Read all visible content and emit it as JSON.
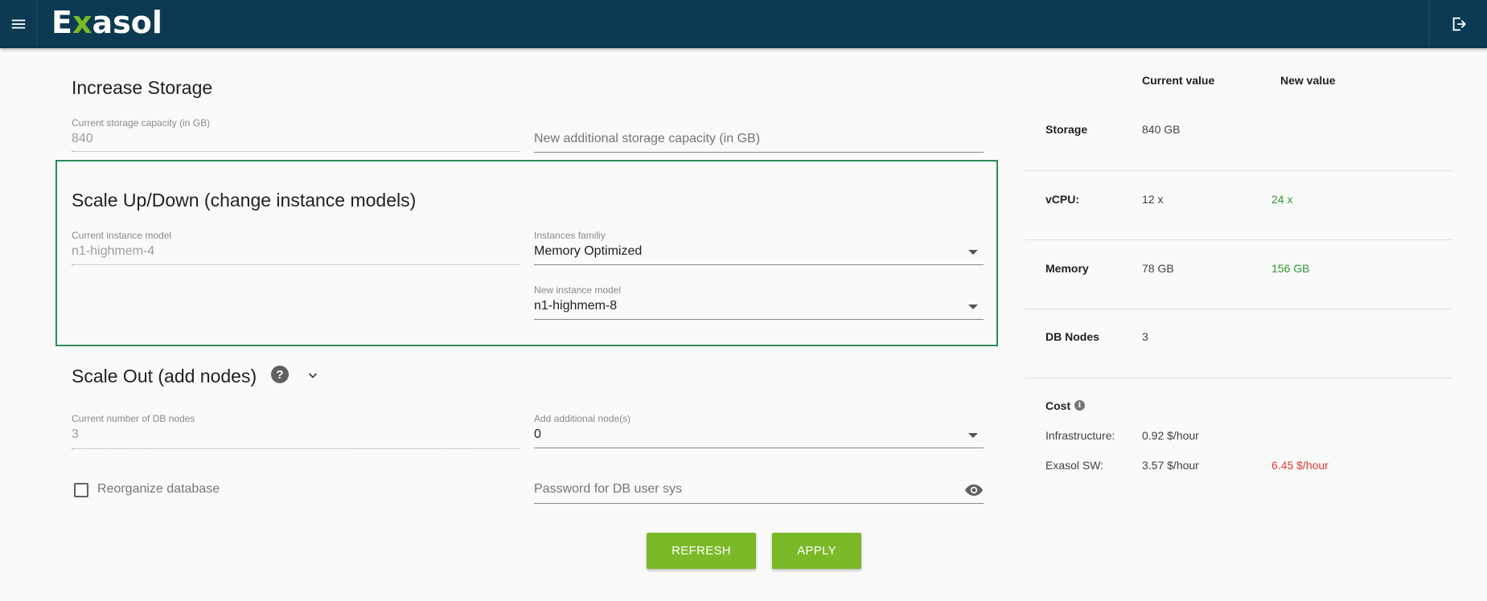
{
  "header": {
    "logo_pre": "E",
    "logo_x": "x",
    "logo_post": "asol",
    "menu_icon": "hamburger-menu-icon",
    "logout_icon": "logout-icon"
  },
  "storage": {
    "title": "Increase Storage",
    "current_label": "Current storage capacity (in GB)",
    "current_value": "840",
    "new_placeholder": "New additional storage capacity (in GB)"
  },
  "scale_updown": {
    "title": "Scale Up/Down (change instance models)",
    "current_label": "Current instance model",
    "current_value": "n1-highmem-4",
    "family_label": "Instances familiy",
    "family_value": "Memory Optimized",
    "new_model_label": "New instance model",
    "new_model_value": "n1-highmem-8",
    "highlight_color": "#2e8b57"
  },
  "scale_out": {
    "title": "Scale Out (add nodes)",
    "help_icon": "help-circle-icon",
    "chevron_icon": "chevron-down-icon",
    "current_label": "Current number of DB nodes",
    "current_value": "3",
    "add_label": "Add additional node(s)",
    "add_value": "0"
  },
  "reorganize": {
    "label": "Reorganize database",
    "checked": false
  },
  "password": {
    "placeholder": "Password for DB user sys",
    "eye_icon": "eye-icon"
  },
  "buttons": {
    "refresh": "REFRESH",
    "apply": "APPLY",
    "color": "#7ab928"
  },
  "summary": {
    "current_header": "Current value",
    "new_header": "New value",
    "rows": [
      {
        "label": "Storage",
        "current": "840 GB",
        "new": ""
      },
      {
        "label": "vCPU:",
        "current": "12 x",
        "new": "24 x"
      },
      {
        "label": "Memory",
        "current": "78 GB",
        "new": "156 GB"
      },
      {
        "label": "DB Nodes",
        "current": "3",
        "new": ""
      }
    ],
    "cost": {
      "label": "Cost",
      "info_icon": "info-icon",
      "infra_label": "Infrastructure:",
      "infra_current": "0.92 $/hour",
      "infra_new": "",
      "sw_label": "Exasol SW:",
      "sw_current": "3.57 $/hour",
      "sw_new": "6.45 $/hour"
    }
  }
}
